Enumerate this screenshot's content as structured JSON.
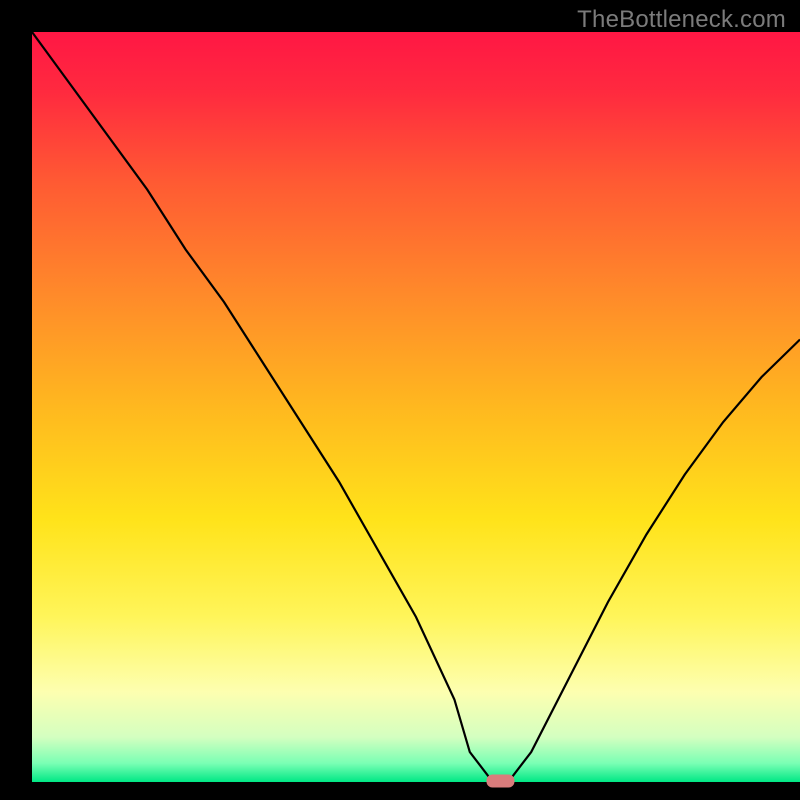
{
  "watermark": "TheBottleneck.com",
  "chart_data": {
    "type": "line",
    "title": "",
    "xlabel": "",
    "ylabel": "",
    "xlim": [
      0,
      100
    ],
    "ylim": [
      0,
      100
    ],
    "x": [
      0,
      5,
      10,
      15,
      20,
      25,
      30,
      35,
      40,
      45,
      50,
      55,
      57,
      60,
      62,
      65,
      70,
      75,
      80,
      85,
      90,
      95,
      100
    ],
    "values": [
      100,
      93,
      86,
      79,
      71,
      64,
      56,
      48,
      40,
      31,
      22,
      11,
      4,
      0,
      0,
      4,
      14,
      24,
      33,
      41,
      48,
      54,
      59
    ],
    "minimum_marker": {
      "x": 61,
      "y": 0
    },
    "background_gradient": {
      "stops": [
        {
          "offset": 0.0,
          "color": "#ff1744"
        },
        {
          "offset": 0.08,
          "color": "#ff2a3f"
        },
        {
          "offset": 0.2,
          "color": "#ff5a33"
        },
        {
          "offset": 0.35,
          "color": "#ff8a2a"
        },
        {
          "offset": 0.5,
          "color": "#ffb81f"
        },
        {
          "offset": 0.65,
          "color": "#ffe31a"
        },
        {
          "offset": 0.78,
          "color": "#fff55a"
        },
        {
          "offset": 0.88,
          "color": "#fdffb0"
        },
        {
          "offset": 0.94,
          "color": "#d4ffc0"
        },
        {
          "offset": 0.975,
          "color": "#7affb4"
        },
        {
          "offset": 1.0,
          "color": "#00e885"
        }
      ]
    },
    "frame_color": "#000000",
    "line_color": "#000000",
    "marker_color": "#d97c7c"
  }
}
